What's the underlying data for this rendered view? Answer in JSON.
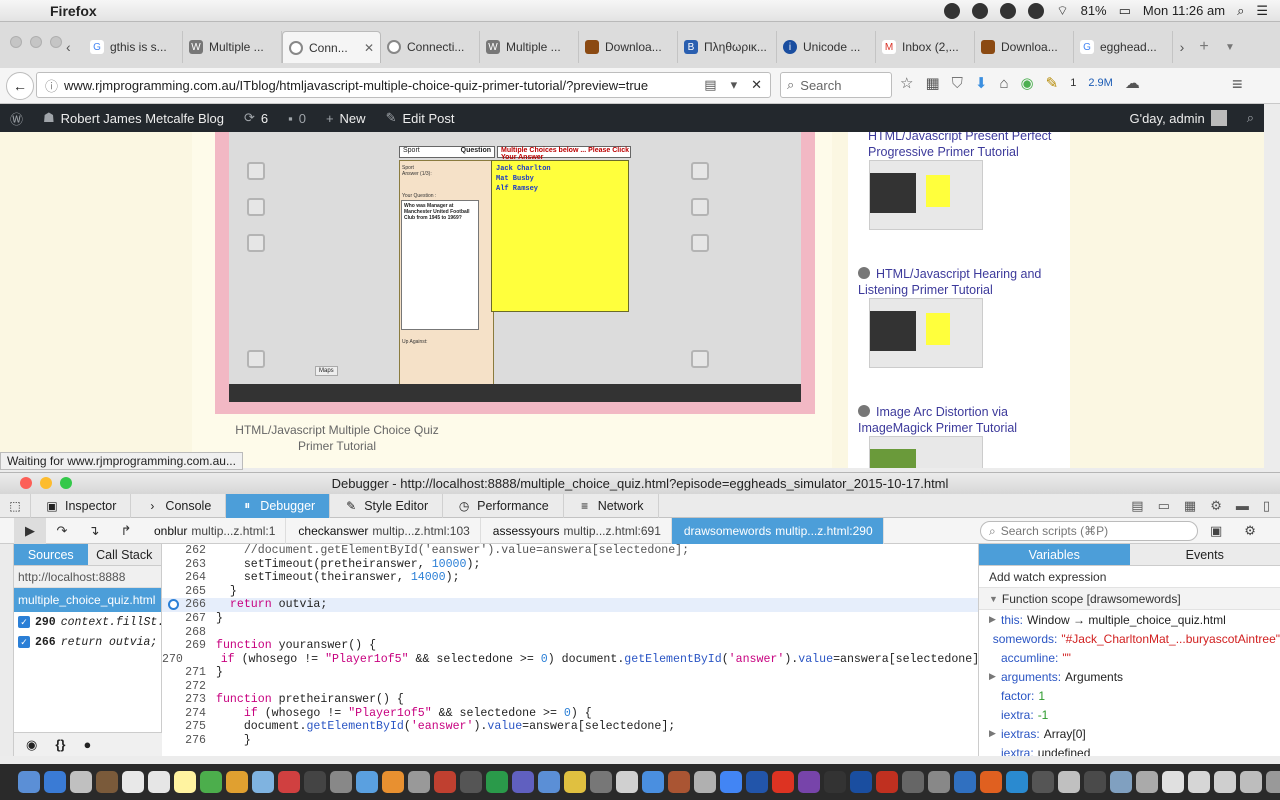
{
  "menubar": {
    "app_name": "Firefox",
    "battery": "81%",
    "clock": "Mon 11:26 am"
  },
  "tabs": [
    {
      "title": "gthis is s...",
      "icon": "G"
    },
    {
      "title": "Multiple ...",
      "icon": "W"
    },
    {
      "title": "Conn...",
      "icon": "",
      "active": true
    },
    {
      "title": "Connecti...",
      "icon": ""
    },
    {
      "title": "Multiple ...",
      "icon": "W"
    },
    {
      "title": "Downloa...",
      "icon": ""
    },
    {
      "title": "Πληθωρικ...",
      "icon": "B"
    },
    {
      "title": "Unicode ...",
      "icon": "i"
    },
    {
      "title": "Inbox (2,...",
      "icon": "M"
    },
    {
      "title": "Downloa...",
      "icon": ""
    },
    {
      "title": "egghead...",
      "icon": "G"
    }
  ],
  "nav": {
    "url": "www.rjmprogramming.com.au/ITblog/htmljavascript-multiple-choice-quiz-primer-tutorial/?preview=true",
    "search_placeholder": "Search",
    "pocket_count": "2.9M",
    "badge": "1"
  },
  "wpbar": {
    "site_name": "Robert James Metcalfe Blog",
    "updates": "6",
    "comments": "0",
    "new_label": "New",
    "edit_label": "Edit Post",
    "greeting": "G'day, admin"
  },
  "content": {
    "caption": "HTML/Javascript Multiple Choice Quiz Primer Tutorial",
    "quiz_header": "Sport",
    "quiz_question_tab": "Question",
    "quiz_choices_tab": "Multiple Choices below ... Please Click Your Answer",
    "quiz_answer_label": "Answer (1/3):",
    "quiz_your_question": "Your Question :",
    "quiz_question": "Who was Manager at Manchester United Football Club from 1945 to 1969?",
    "quiz_choices": [
      "Jack Charlton",
      "Mat Busby",
      "Alf Ramsey"
    ],
    "quiz_up_against": "Up Against:",
    "maps_label": "Maps"
  },
  "sidebar": {
    "items": [
      {
        "title": "HTML/Javascript Present Perfect Progressive Primer Tutorial"
      },
      {
        "title": "HTML/Javascript Hearing and Listening Primer Tutorial"
      },
      {
        "title": "Image Arc Distortion via ImageMagick Primer Tutorial"
      }
    ]
  },
  "status_tip": "Waiting for www.rjmprogramming.com.au...",
  "devtools": {
    "window_title": "Debugger - http://localhost:8888/multiple_choice_quiz.html?episode=eggheads_simulator_2015-10-17.html",
    "tabs": [
      "Inspector",
      "Console",
      "Debugger",
      "Style Editor",
      "Performance",
      "Network"
    ],
    "active_tab": "Debugger",
    "callstack": [
      {
        "fn": "onblur",
        "loc": "multip...z.html:1"
      },
      {
        "fn": "checkanswer",
        "loc": "multip...z.html:103"
      },
      {
        "fn": "assessyours",
        "loc": "multip...z.html:691"
      },
      {
        "fn": "drawsomewords",
        "loc": "multip...z.html:290",
        "active": true
      }
    ],
    "search_placeholder": "Search scripts (⌘P)",
    "sources_tab": "Sources",
    "callstack_tab": "Call Stack",
    "host": "http://localhost:8888",
    "file": "multiple_choice_quiz.html",
    "breakpoints": [
      {
        "line": "290",
        "expr": "context.fillSt..."
      },
      {
        "line": "266",
        "expr": "return outvia;"
      }
    ],
    "code_lines": [
      {
        "n": "262",
        "code": "    //document.getElementById('eanswer').value=answera[selectedone];"
      },
      {
        "n": "263",
        "code": "    setTimeout(pretheiranswer, 10000);"
      },
      {
        "n": "264",
        "code": "    setTimeout(theiranswer, 14000);"
      },
      {
        "n": "265",
        "code": "  }"
      },
      {
        "n": "266",
        "code": "  return outvia;",
        "current": true
      },
      {
        "n": "267",
        "code": "}"
      },
      {
        "n": "268",
        "code": ""
      },
      {
        "n": "269",
        "code": "function youranswer() {"
      },
      {
        "n": "270",
        "code": "    if (whosego != \"Player1of5\" && selectedone >= 0) document.getElementById('answer').value=answera[selectedone];"
      },
      {
        "n": "271",
        "code": "}"
      },
      {
        "n": "272",
        "code": ""
      },
      {
        "n": "273",
        "code": "function pretheiranswer() {"
      },
      {
        "n": "274",
        "code": "    if (whosego != \"Player1of5\" && selectedone >= 0) {"
      },
      {
        "n": "275",
        "code": "    document.getElementById('eanswer').value=answera[selectedone];"
      },
      {
        "n": "276",
        "code": "    }"
      }
    ],
    "variables_tab": "Variables",
    "events_tab": "Events",
    "watch_label": "Add watch expression",
    "scope_label": "Function scope [drawsomewords]",
    "variables": [
      {
        "key": "this",
        "value": "Window → multiple_choice_quiz.html",
        "expand": true,
        "kind": "obj"
      },
      {
        "key": "somewords",
        "value": "\"#Jack_CharltonMat_...buryascotAintree\"",
        "kind": "str"
      },
      {
        "key": "accumline",
        "value": "\"\"",
        "kind": "str"
      },
      {
        "key": "arguments",
        "value": "Arguments",
        "expand": true,
        "kind": "obj"
      },
      {
        "key": "factor",
        "value": "1",
        "kind": "num"
      },
      {
        "key": "iextra",
        "value": "-1",
        "kind": "num"
      },
      {
        "key": "iextras",
        "value": "Array[0]",
        "expand": true,
        "kind": "obj"
      },
      {
        "key": "iextra",
        "value": "undefined",
        "kind": "obj"
      }
    ]
  }
}
